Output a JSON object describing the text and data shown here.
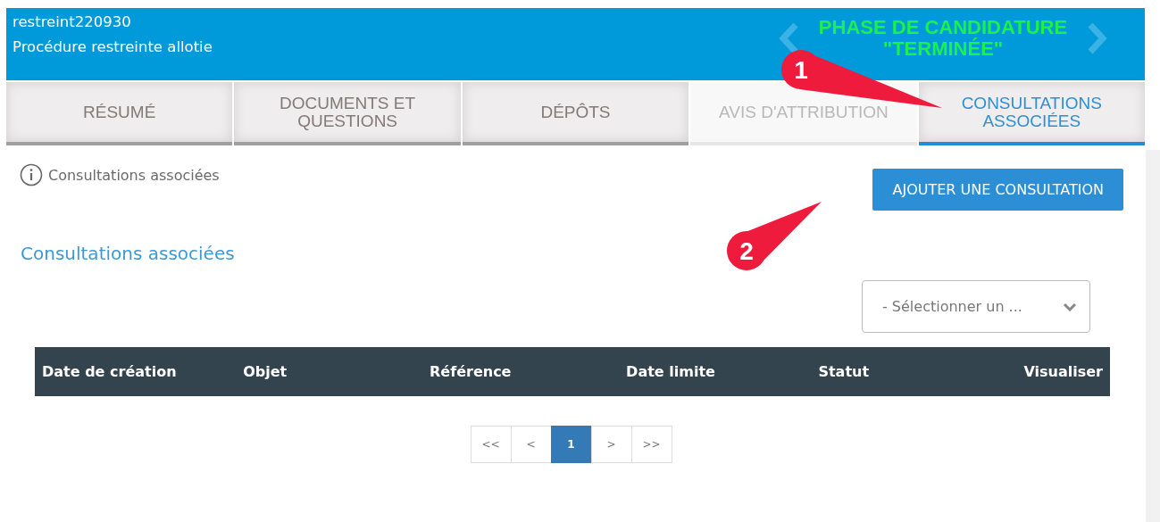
{
  "header": {
    "reference": "restreint220930",
    "procedure": "Procédure restreinte allotie",
    "phase": "PHASE DE CANDIDATURE \"TERMINÉE\""
  },
  "tabs": [
    {
      "label": "RÉSUMÉ",
      "selected": false,
      "disabled": false
    },
    {
      "label": "DOCUMENTS ET QUESTIONS",
      "selected": false,
      "disabled": false
    },
    {
      "label": "DÉPÔTS",
      "selected": false,
      "disabled": false
    },
    {
      "label": "AVIS D'ATTRIBUTION",
      "selected": false,
      "disabled": true
    },
    {
      "label": "CONSULTATIONS ASSOCIÉES",
      "selected": true,
      "disabled": false
    }
  ],
  "info": "Consultations associées",
  "add_button": "AJOUTER UNE CONSULTATION",
  "section_title": "Consultations associées",
  "filter": {
    "value": "- Sélectionner un ..."
  },
  "table": {
    "columns": [
      "Date de création",
      "Objet",
      "Référence",
      "Date limite",
      "Statut",
      "Visualiser"
    ]
  },
  "pagination": [
    {
      "label": "<<",
      "selected": false
    },
    {
      "label": "<",
      "selected": false
    },
    {
      "label": "1",
      "selected": true
    },
    {
      "label": ">",
      "selected": false
    },
    {
      "label": ">>",
      "selected": false
    }
  ],
  "annotations": [
    {
      "label": "1"
    },
    {
      "label": "2"
    }
  ]
}
